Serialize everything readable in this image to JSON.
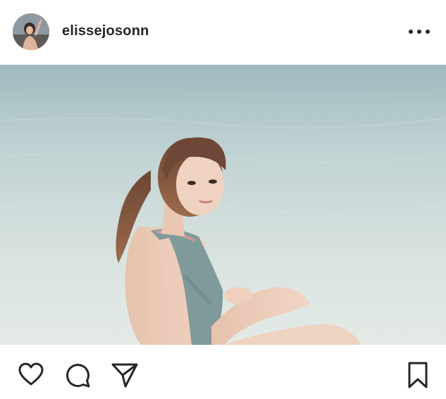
{
  "post": {
    "username": "elissejosonn"
  },
  "icons": {
    "avatar": "profile-photo",
    "more": "more-options-icon",
    "like": "heart-icon",
    "comment": "comment-icon",
    "share": "send-icon",
    "save": "bookmark-icon"
  },
  "colors": {
    "text": "#262626",
    "background": "#ffffff"
  }
}
